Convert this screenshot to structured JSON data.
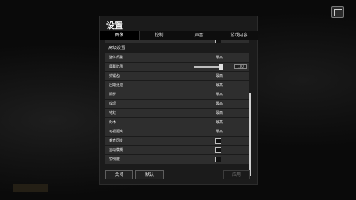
{
  "dialog": {
    "title": "设置",
    "tabs": [
      {
        "label": "图像",
        "active": true
      },
      {
        "label": "控制",
        "active": false
      },
      {
        "label": "声音",
        "active": false
      },
      {
        "label": "游戏内容",
        "active": false
      }
    ]
  },
  "settings": {
    "section_header": "高级设置",
    "rows": [
      {
        "label": "整体质量",
        "value": "最高"
      },
      {
        "label": "屏幕比例",
        "value": "100"
      },
      {
        "label": "抗锯齿",
        "value": "最高"
      },
      {
        "label": "后期处理",
        "value": "最高"
      },
      {
        "label": "阴影",
        "value": "最高"
      },
      {
        "label": "纹理",
        "value": "最高"
      },
      {
        "label": "特效",
        "value": "最高"
      },
      {
        "label": "树木",
        "value": "最高"
      },
      {
        "label": "可视距离",
        "value": "最高"
      },
      {
        "label": "垂直同步",
        "checked": false
      },
      {
        "label": "运动模糊",
        "checked": false
      },
      {
        "label": "锐明度",
        "checked": false
      }
    ],
    "scale_slider_level": 100
  },
  "footer": {
    "close_label": "关闭",
    "default_label": "默认",
    "apply_label": "应用"
  },
  "colors": {
    "dialog_bg": "#1b1b1b",
    "row_bg": "#2e2e2e",
    "active_tab_bg": "#000000"
  }
}
